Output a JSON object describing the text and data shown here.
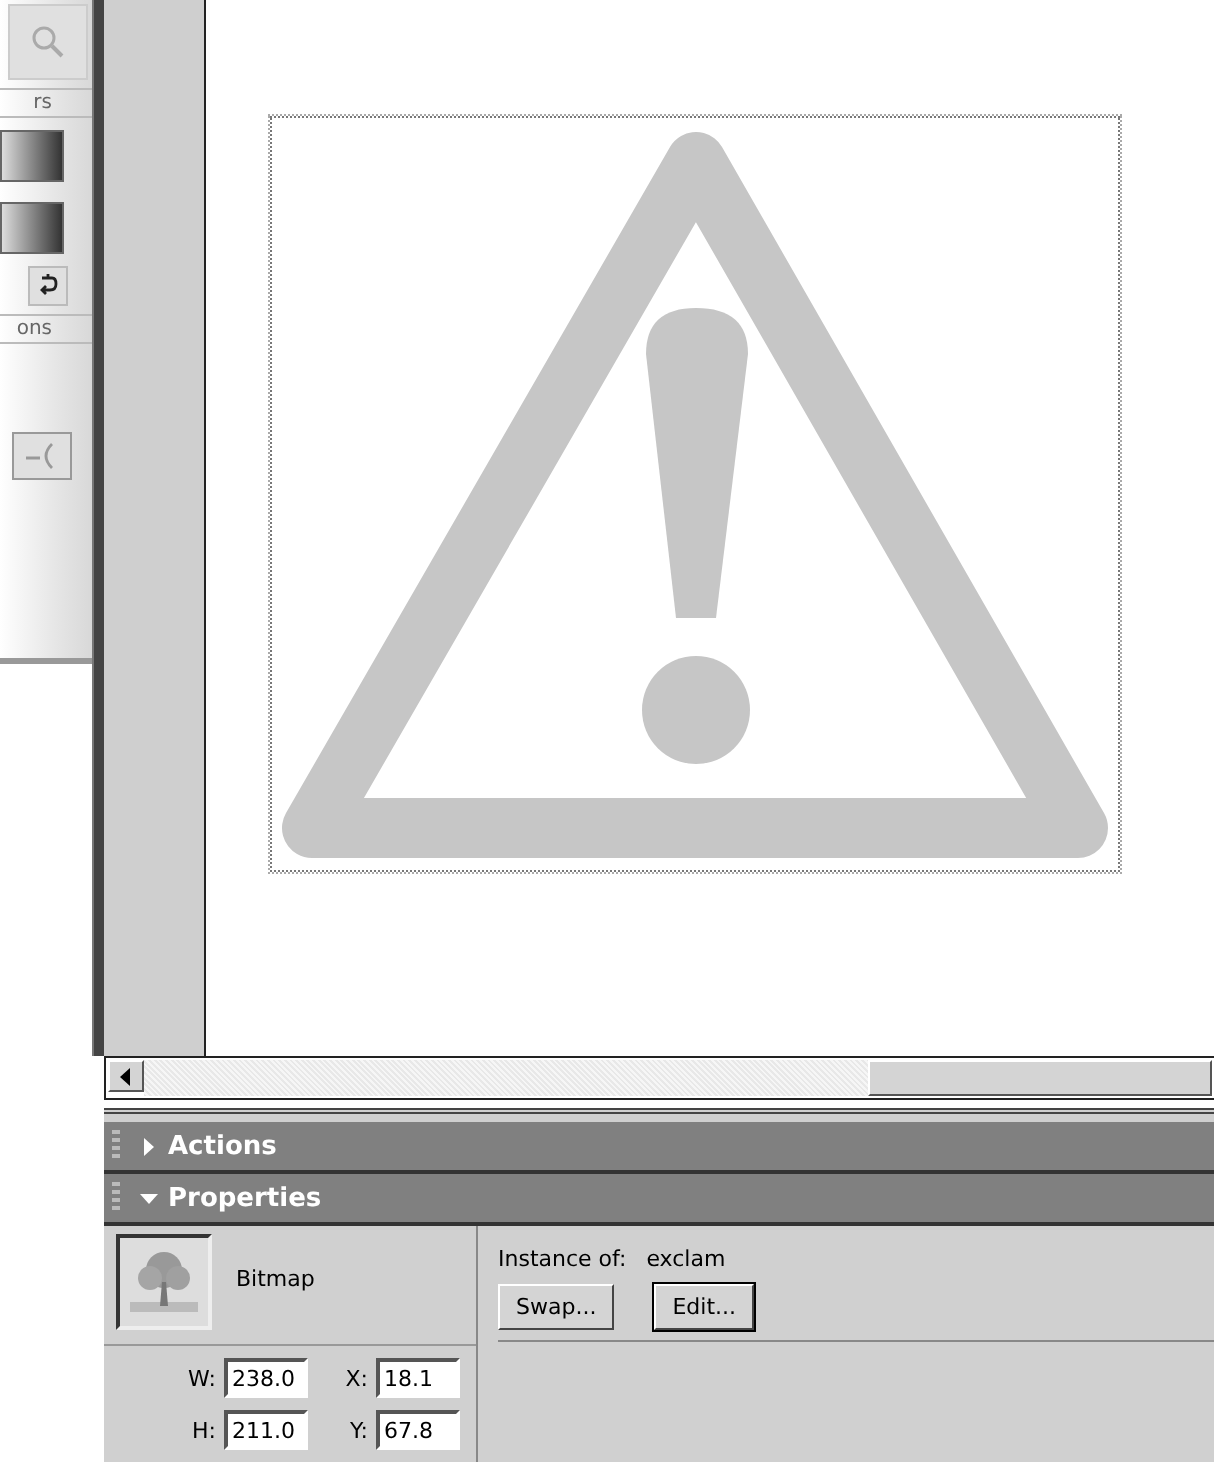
{
  "tools_panel": {
    "section_headers": [
      "rs",
      "ons"
    ]
  },
  "stage": {
    "bitmap": {
      "selected": true
    }
  },
  "panels": [
    {
      "title": "Actions",
      "expanded": false
    },
    {
      "title": "Properties",
      "expanded": true
    }
  ],
  "properties": {
    "type": "Bitmap",
    "instance_label": "Instance of:",
    "instance_name": "exclam",
    "buttons": [
      {
        "label": "Swap...",
        "default": false
      },
      {
        "label": "Edit...",
        "default": true
      }
    ],
    "fields": [
      {
        "label": "W:",
        "value": "238.0"
      },
      {
        "label": "X:",
        "value": "18.1"
      },
      {
        "label": "H:",
        "value": "211.0"
      },
      {
        "label": "Y:",
        "value": "67.8"
      }
    ]
  }
}
